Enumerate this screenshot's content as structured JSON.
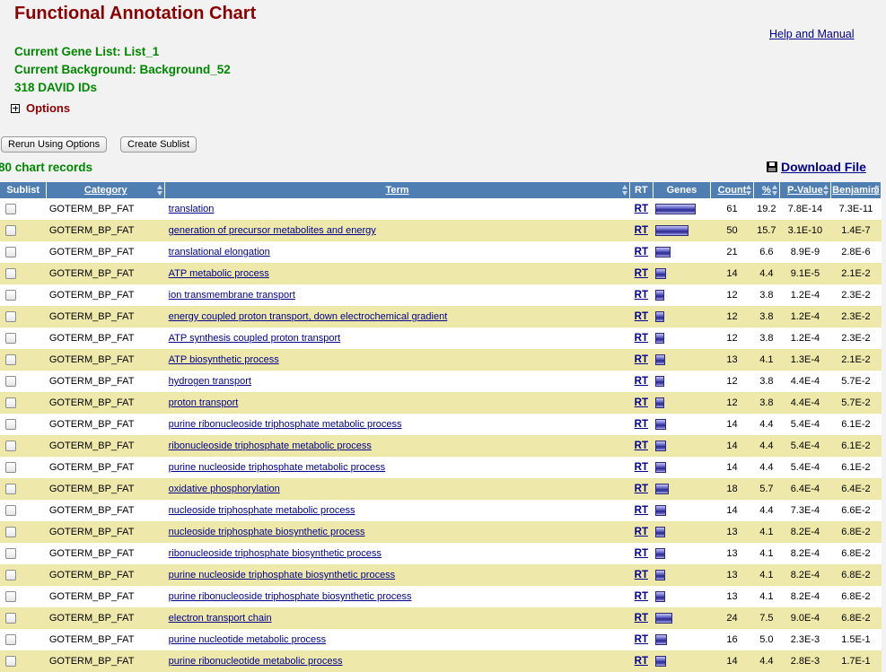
{
  "page": {
    "title": "Functional Annotation Chart",
    "help_link": "Help and Manual",
    "gene_list": "Current Gene List: List_1",
    "background": "Current Background: Background_52",
    "david_ids": "318 DAVID IDs",
    "options_label": "Options",
    "rerun_button": "Rerun Using Options",
    "create_sublist_button": "Create Sublist",
    "records_count": "80 chart records",
    "download_file": "Download File"
  },
  "colors": {
    "title": "#8b0000",
    "info_green": "#008800",
    "header_blue": "#4f7eb3",
    "row_alt": "#eee8aa",
    "link": "#00008b"
  },
  "table": {
    "headers": [
      "Sublist",
      "Category",
      "Term",
      "RT",
      "Genes",
      "Count",
      "%",
      "P-Value",
      "Benjamini"
    ],
    "rows": [
      {
        "category": "GOTERM_BP_FAT",
        "term": "translation",
        "rt": "RT",
        "count": "61",
        "percent": "19.2",
        "pvalue": "7.8E-14",
        "benjamini": "7.3E-11"
      },
      {
        "category": "GOTERM_BP_FAT",
        "term": "generation of precursor metabolites and energy",
        "rt": "RT",
        "count": "50",
        "percent": "15.7",
        "pvalue": "3.1E-10",
        "benjamini": "1.4E-7"
      },
      {
        "category": "GOTERM_BP_FAT",
        "term": "translational elongation",
        "rt": "RT",
        "count": "21",
        "percent": "6.6",
        "pvalue": "8.9E-9",
        "benjamini": "2.8E-6"
      },
      {
        "category": "GOTERM_BP_FAT",
        "term": "ATP metabolic process",
        "rt": "RT",
        "count": "14",
        "percent": "4.4",
        "pvalue": "9.1E-5",
        "benjamini": "2.1E-2"
      },
      {
        "category": "GOTERM_BP_FAT",
        "term": "ion transmembrane transport",
        "rt": "RT",
        "count": "12",
        "percent": "3.8",
        "pvalue": "1.2E-4",
        "benjamini": "2.3E-2"
      },
      {
        "category": "GOTERM_BP_FAT",
        "term": "energy coupled proton transport, down electrochemical gradient",
        "rt": "RT",
        "count": "12",
        "percent": "3.8",
        "pvalue": "1.2E-4",
        "benjamini": "2.3E-2"
      },
      {
        "category": "GOTERM_BP_FAT",
        "term": "ATP synthesis coupled proton transport",
        "rt": "RT",
        "count": "12",
        "percent": "3.8",
        "pvalue": "1.2E-4",
        "benjamini": "2.3E-2"
      },
      {
        "category": "GOTERM_BP_FAT",
        "term": "ATP biosynthetic process",
        "rt": "RT",
        "count": "13",
        "percent": "4.1",
        "pvalue": "1.3E-4",
        "benjamini": "2.1E-2"
      },
      {
        "category": "GOTERM_BP_FAT",
        "term": "hydrogen transport",
        "rt": "RT",
        "count": "12",
        "percent": "3.8",
        "pvalue": "4.4E-4",
        "benjamini": "5.7E-2"
      },
      {
        "category": "GOTERM_BP_FAT",
        "term": "proton transport",
        "rt": "RT",
        "count": "12",
        "percent": "3.8",
        "pvalue": "4.4E-4",
        "benjamini": "5.7E-2"
      },
      {
        "category": "GOTERM_BP_FAT",
        "term": "purine ribonucleoside triphosphate metabolic process",
        "rt": "RT",
        "count": "14",
        "percent": "4.4",
        "pvalue": "5.4E-4",
        "benjamini": "6.1E-2"
      },
      {
        "category": "GOTERM_BP_FAT",
        "term": "ribonucleoside triphosphate metabolic process",
        "rt": "RT",
        "count": "14",
        "percent": "4.4",
        "pvalue": "5.4E-4",
        "benjamini": "6.1E-2"
      },
      {
        "category": "GOTERM_BP_FAT",
        "term": "purine nucleoside triphosphate metabolic process",
        "rt": "RT",
        "count": "14",
        "percent": "4.4",
        "pvalue": "5.4E-4",
        "benjamini": "6.1E-2"
      },
      {
        "category": "GOTERM_BP_FAT",
        "term": "oxidative phosphorylation",
        "rt": "RT",
        "count": "18",
        "percent": "5.7",
        "pvalue": "6.4E-4",
        "benjamini": "6.4E-2"
      },
      {
        "category": "GOTERM_BP_FAT",
        "term": "nucleoside triphosphate metabolic process",
        "rt": "RT",
        "count": "14",
        "percent": "4.4",
        "pvalue": "7.3E-4",
        "benjamini": "6.6E-2"
      },
      {
        "category": "GOTERM_BP_FAT",
        "term": "nucleoside triphosphate biosynthetic process",
        "rt": "RT",
        "count": "13",
        "percent": "4.1",
        "pvalue": "8.2E-4",
        "benjamini": "6.8E-2"
      },
      {
        "category": "GOTERM_BP_FAT",
        "term": "ribonucleoside triphosphate biosynthetic process",
        "rt": "RT",
        "count": "13",
        "percent": "4.1",
        "pvalue": "8.2E-4",
        "benjamini": "6.8E-2"
      },
      {
        "category": "GOTERM_BP_FAT",
        "term": "purine nucleoside triphosphate biosynthetic process",
        "rt": "RT",
        "count": "13",
        "percent": "4.1",
        "pvalue": "8.2E-4",
        "benjamini": "6.8E-2"
      },
      {
        "category": "GOTERM_BP_FAT",
        "term": "purine ribonucleoside triphosphate biosynthetic process",
        "rt": "RT",
        "count": "13",
        "percent": "4.1",
        "pvalue": "8.2E-4",
        "benjamini": "6.8E-2"
      },
      {
        "category": "GOTERM_BP_FAT",
        "term": "electron transport chain",
        "rt": "RT",
        "count": "24",
        "percent": "7.5",
        "pvalue": "9.0E-4",
        "benjamini": "6.8E-2"
      },
      {
        "category": "GOTERM_BP_FAT",
        "term": "purine nucleotide metabolic process",
        "rt": "RT",
        "count": "16",
        "percent": "5.0",
        "pvalue": "2.3E-3",
        "benjamini": "1.5E-1"
      },
      {
        "category": "GOTERM_BP_FAT",
        "term": "purine ribonucleotide metabolic process",
        "rt": "RT",
        "count": "14",
        "percent": "4.4",
        "pvalue": "2.8E-3",
        "benjamini": "1.7E-1"
      }
    ]
  }
}
